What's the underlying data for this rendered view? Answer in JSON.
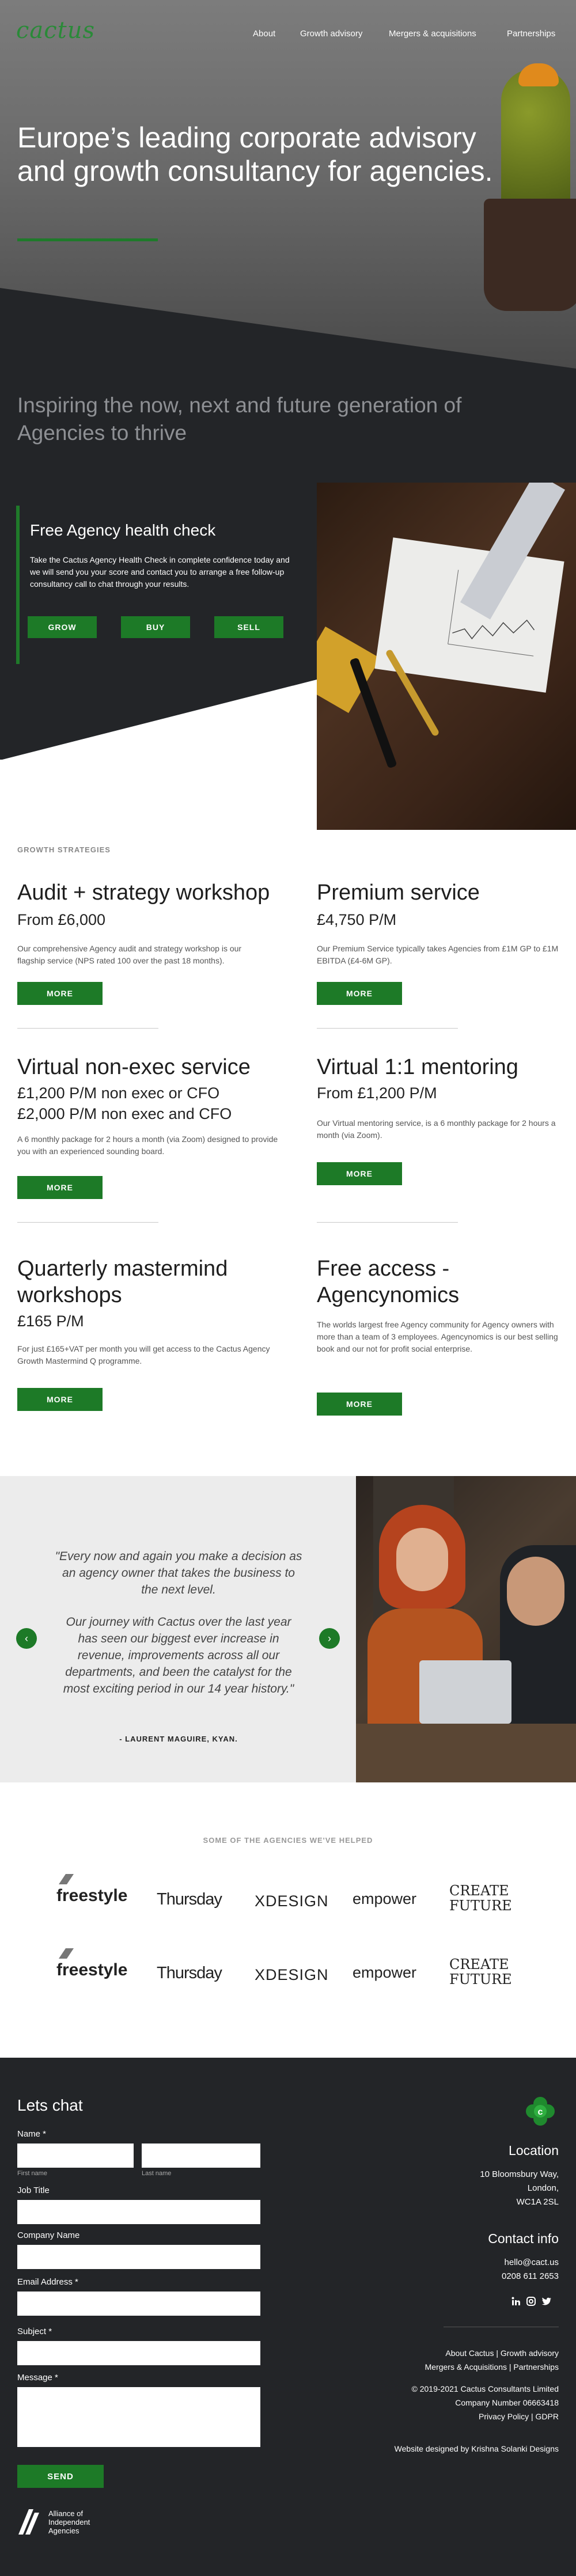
{
  "header": {
    "logo_text": "cactus",
    "nav": [
      "About",
      "Growth advisory",
      "Mergers & acquisitions",
      "Partnerships"
    ]
  },
  "hero": {
    "title": "Europe’s leading corporate advisory and growth consultancy for agencies.",
    "tagline": "Inspiring the now, next and future generation of Agencies to thrive"
  },
  "health_check": {
    "title": "Free Agency health check",
    "text": "Take the Cactus Agency Health Check in complete confidence today and we will send you your score and contact you to arrange a free follow-up consultancy call to chat through your results.",
    "buttons": [
      "GROW",
      "BUY",
      "SELL"
    ]
  },
  "services": {
    "section_label": "GROWTH STRATEGIES",
    "more_label": "MORE",
    "items": [
      {
        "title": "Audit + strategy workshop",
        "price": "From £6,000",
        "desc": "Our comprehensive Agency audit and strategy workshop is our flagship service (NPS rated 100 over the past 18 months)."
      },
      {
        "title": "Premium service",
        "price": "£4,750 P/M",
        "desc": "Our Premium Service typically takes Agencies from £1M GP to £1M EBITDA (£4-6M GP)."
      },
      {
        "title": "Virtual non-exec service",
        "price": "£1,200 P/M non exec or CFO",
        "price2": "£2,000 P/M non exec and CFO",
        "desc": "A 6 monthly package for 2 hours a month (via Zoom) designed to provide you with an experienced sounding board."
      },
      {
        "title": "Virtual 1:1 mentoring",
        "price": "From £1,200 P/M",
        "desc": "Our Virtual mentoring service, is a 6 monthly package for 2 hours a month (via Zoom)."
      },
      {
        "title": "Quarterly mastermind workshops",
        "price": "£165 P/M",
        "desc": "For just £165+VAT per month you will get access to the Cactus Agency Growth Mastermind Q programme."
      },
      {
        "title": "Free access - Agencynomics",
        "price": "",
        "desc": "The worlds largest free Agency community for Agency owners with more than a team of 3 employees. Agencynomics is our best selling book and our not for profit social enterprise."
      }
    ]
  },
  "testimonial": {
    "quote1": "\"Every now and again you make a decision as an agency owner that takes the business to the next level.",
    "quote2": "Our journey with Cactus over the last year has seen our biggest ever increase in revenue, improvements across all our departments, and been the catalyst for the most exciting period in our 14 year history.\"",
    "author": "- LAURENT MAGUIRE, KYAN."
  },
  "agencies": {
    "title": "SOME OF THE AGENCIES WE'VE HELPED",
    "row1": [
      "freestyle",
      "Thursday",
      "XDESIGN",
      "empower",
      "CREATE FUTURE"
    ],
    "row2": [
      "freestyle",
      "Thursday",
      "XDESIGN",
      "empower",
      "CREATE FUTURE"
    ]
  },
  "footer": {
    "heading": "Lets chat",
    "fields": {
      "name": "Name *",
      "first": "First name",
      "last": "Last name",
      "job": "Job Title",
      "company": "Company Name",
      "email": "Email Address *",
      "subject": "Subject *",
      "message": "Message *"
    },
    "send": "SEND",
    "aiia": "Alliance of Independent Agencies",
    "location_title": "Location",
    "address": [
      "10 Bloomsbury Way,",
      "London,",
      "WC1A 2SL"
    ],
    "contact_title": "Contact info",
    "email": "hello@cact.us",
    "phone": "0208 611 2653",
    "social_icons": [
      "linkedin-icon",
      "instagram-icon",
      "twitter-icon"
    ],
    "links1": "About Cactus | Growth advisory",
    "links2": "Mergers & Acquisitions | Partnerships",
    "copyright": "© 2019-2021 Cactus Consultants Limited",
    "company_number": "Company Number 06663418",
    "privacy": "Privacy Policy | GDPR",
    "credit": "Website designed by Krishna Solanki Designs"
  },
  "colors": {
    "accent": "#1d7a27",
    "dark": "#232528"
  }
}
